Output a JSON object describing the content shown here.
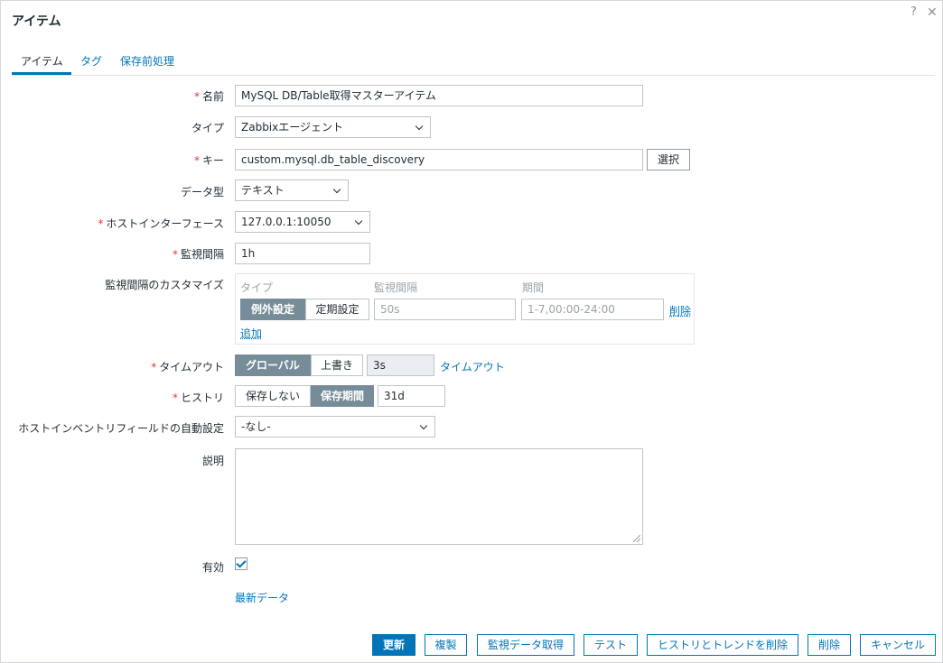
{
  "dialog": {
    "title": "アイテム",
    "help_label": "?",
    "close_label": "✕"
  },
  "tabs": [
    {
      "label": "アイテム",
      "active": true
    },
    {
      "label": "タグ"
    },
    {
      "label": "保存前処理"
    }
  ],
  "required_mark": "*",
  "form": {
    "name": {
      "label": "名前",
      "value": "MySQL DB/Table取得マスターアイテム"
    },
    "type": {
      "label": "タイプ",
      "value": "Zabbixエージェント"
    },
    "key": {
      "label": "キー",
      "value": "custom.mysql.db_table_discovery",
      "select_label": "選択"
    },
    "data_type": {
      "label": "データ型",
      "value": "テキスト"
    },
    "host_interface": {
      "label": "ホストインターフェース",
      "value": "127.0.0.1:10050"
    },
    "interval": {
      "label": "監視間隔",
      "value": "1h"
    },
    "custom_intervals": {
      "label": "監視間隔のカスタマイズ",
      "columns": [
        "タイプ",
        "監視間隔",
        "期間"
      ],
      "seg_flexible": "例外設定",
      "seg_scheduling": "定期設定",
      "interval_placeholder": "50s",
      "period_placeholder": "1-7,00:00-24:00",
      "remove_label": "削除",
      "add_label": "追加"
    },
    "timeout": {
      "label": "タイムアウト",
      "seg_global": "グローバル",
      "seg_override": "上書き",
      "value": "3s",
      "link": "タイムアウト"
    },
    "history": {
      "label": "ヒストリ",
      "seg_none": "保存しない",
      "seg_period": "保存期間",
      "value": "31d"
    },
    "inventory": {
      "label": "ホストインベントリフィールドの自動設定",
      "value": "-なし-"
    },
    "description": {
      "label": "説明",
      "value": ""
    },
    "enabled": {
      "label": "有効",
      "checked": true
    },
    "latest_data_link": "最新データ"
  },
  "footer": {
    "update": "更新",
    "clone": "複製",
    "get_value": "監視データ取得",
    "test": "テスト",
    "clear_history": "ヒストリとトレンドを削除",
    "delete": "削除",
    "cancel": "キャンセル"
  },
  "colors": {
    "accent": "#0275b8",
    "required": "#e33734",
    "segment_active": "#768d99"
  }
}
